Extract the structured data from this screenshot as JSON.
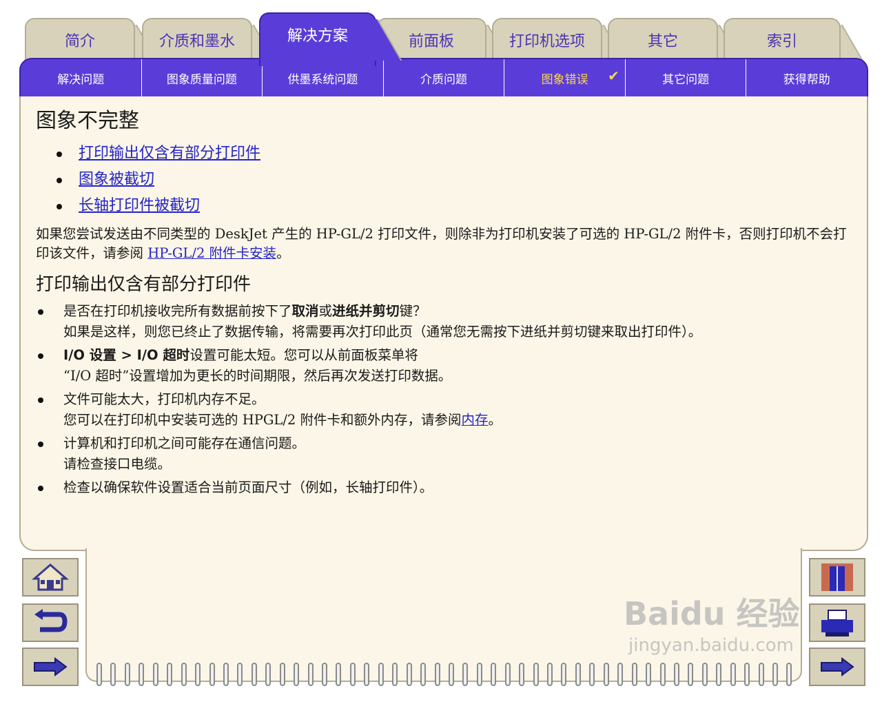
{
  "tabs": [
    "简介",
    "介质和墨水",
    "解决方案",
    "前面板",
    "打印机选项",
    "其它",
    "索引"
  ],
  "subnav": [
    "解决问题",
    "图象质量问题",
    "供墨系统问题",
    "介质问题",
    "图象错误",
    "其它问题",
    "获得帮助"
  ],
  "subnav_check": "✔",
  "content": {
    "title": "图象不完整",
    "links": [
      "打印输出仅含有部分打印件",
      "图象被截切",
      "长轴打印件被截切"
    ],
    "intro_text": "如果您尝试发送由不同类型的 DeskJet 产生的 HP-GL/2 打印文件，则除非为打印机安装了可选的 HP-GL/2 附件卡，否则打印机不会打印该文件，请参阅 ",
    "intro_link": "HP-GL/2 附件卡安装",
    "intro_end": "。",
    "section_title": "打印输出仅含有部分打印件",
    "item1_a": "是否在打印机接收完所有数据前按下了",
    "item1_b1": "取消",
    "item1_or": "或",
    "item1_b2": "进纸并剪切",
    "item1_c": "键？",
    "item1_line2": "如果是这样，则您已终止了数据传输，将需要再次打印此页（通常您无需按下进纸并剪切键来取出打印件）。",
    "item2_b": "I/O 设置 > I/O 超时",
    "item2_a": "设置可能太短。您可以从前面板菜单将",
    "item2_line2": "“I/O 超时”设置增加为更长的时间期限，然后再次发送打印数据。",
    "item3_line1": "文件可能太大，打印机内存不足。",
    "item3_line2": "您可以在打印机中安装可选的 HPGL/2 附件卡和额外内存，请参阅",
    "item3_link": "内存",
    "item3_end": "。",
    "item4_line1": "计算机和打印机之间可能存在通信问题。",
    "item4_line2": "请检查接口电缆。",
    "item5_line1": "检查以确保软件设置适合当前页面尺寸（例如，长轴打印件）。"
  },
  "watermark": "Baidu 经验",
  "watermark_sub": "jingyan.baidu.com"
}
